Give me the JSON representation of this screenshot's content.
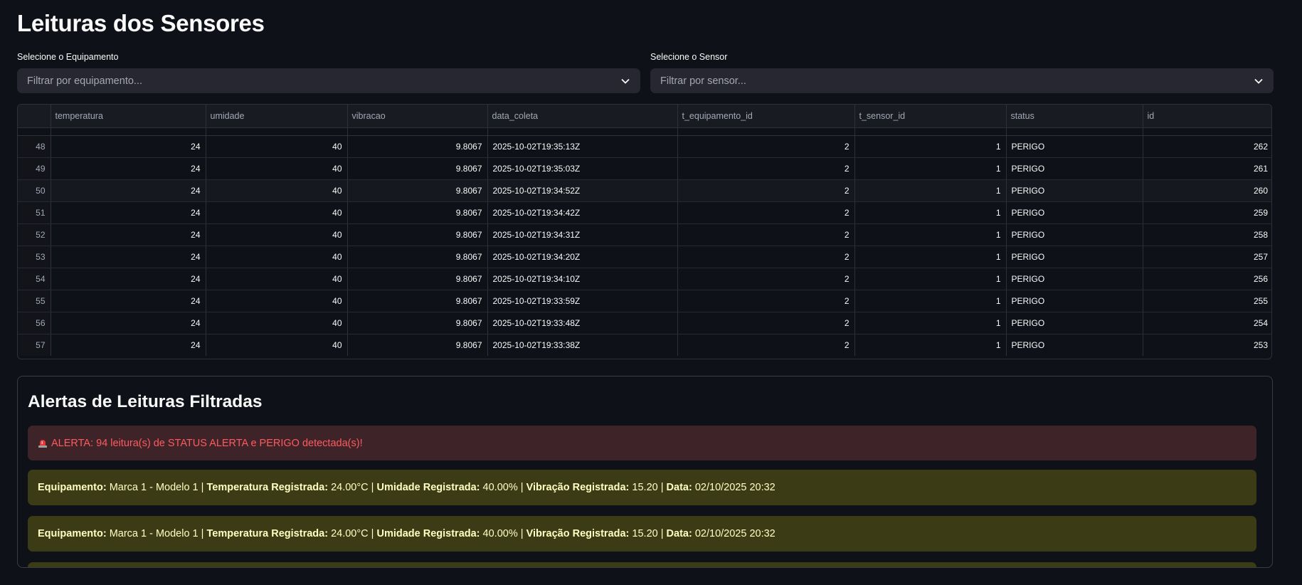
{
  "page": {
    "title": "Leituras dos Sensores"
  },
  "filters": {
    "equipment": {
      "label": "Selecione o Equipamento",
      "placeholder": "Filtrar por equipamento..."
    },
    "sensor": {
      "label": "Selecione o Sensor",
      "placeholder": "Filtrar por sensor..."
    }
  },
  "table": {
    "columns": [
      "",
      "temperatura",
      "umidade",
      "vibracao",
      "data_coleta",
      "t_equipamento_id",
      "t_sensor_id",
      "status",
      "id"
    ],
    "rows": [
      [
        "48",
        "24",
        "40",
        "9.8067",
        "2025-10-02T19:35:13Z",
        "2",
        "1",
        "PERIGO",
        "262"
      ],
      [
        "49",
        "24",
        "40",
        "9.8067",
        "2025-10-02T19:35:03Z",
        "2",
        "1",
        "PERIGO",
        "261"
      ],
      [
        "50",
        "24",
        "40",
        "9.8067",
        "2025-10-02T19:34:52Z",
        "2",
        "1",
        "PERIGO",
        "260"
      ],
      [
        "51",
        "24",
        "40",
        "9.8067",
        "2025-10-02T19:34:42Z",
        "2",
        "1",
        "PERIGO",
        "259"
      ],
      [
        "52",
        "24",
        "40",
        "9.8067",
        "2025-10-02T19:34:31Z",
        "2",
        "1",
        "PERIGO",
        "258"
      ],
      [
        "53",
        "24",
        "40",
        "9.8067",
        "2025-10-02T19:34:20Z",
        "2",
        "1",
        "PERIGO",
        "257"
      ],
      [
        "54",
        "24",
        "40",
        "9.8067",
        "2025-10-02T19:34:10Z",
        "2",
        "1",
        "PERIGO",
        "256"
      ],
      [
        "55",
        "24",
        "40",
        "9.8067",
        "2025-10-02T19:33:59Z",
        "2",
        "1",
        "PERIGO",
        "255"
      ],
      [
        "56",
        "24",
        "40",
        "9.8067",
        "2025-10-02T19:33:48Z",
        "2",
        "1",
        "PERIGO",
        "254"
      ],
      [
        "57",
        "24",
        "40",
        "9.8067",
        "2025-10-02T19:33:38Z",
        "2",
        "1",
        "PERIGO",
        "253"
      ]
    ]
  },
  "alerts": {
    "title": "Alertas de Leituras Filtradas",
    "error": {
      "icon": "siren-icon",
      "text": "ALERTA: 94 leitura(s) de STATUS ALERTA e PERIGO detectada(s)!"
    },
    "labels": {
      "equipment": "Equipamento:",
      "temperature": "Temperatura Registrada:",
      "humidity": "Umidade Registrada:",
      "vibration": "Vibração Registrada:",
      "date": "Data:"
    },
    "separator": "|",
    "items": [
      {
        "equipment": "Marca 1 - Modelo 1",
        "temperature": "24.00°C",
        "humidity": "40.00%",
        "vibration": "15.20",
        "date": "02/10/2025 20:32"
      },
      {
        "equipment": "Marca 1 - Modelo 1",
        "temperature": "24.00°C",
        "humidity": "40.00%",
        "vibration": "15.20",
        "date": "02/10/2025 20:32"
      }
    ]
  },
  "colors": {
    "background": "#0e1117",
    "input_bg": "#262730",
    "error_bg": "#3e2428",
    "error_text": "#ff5a5f",
    "warning_bg": "#3b3c16",
    "warning_text": "#ffffc2"
  }
}
